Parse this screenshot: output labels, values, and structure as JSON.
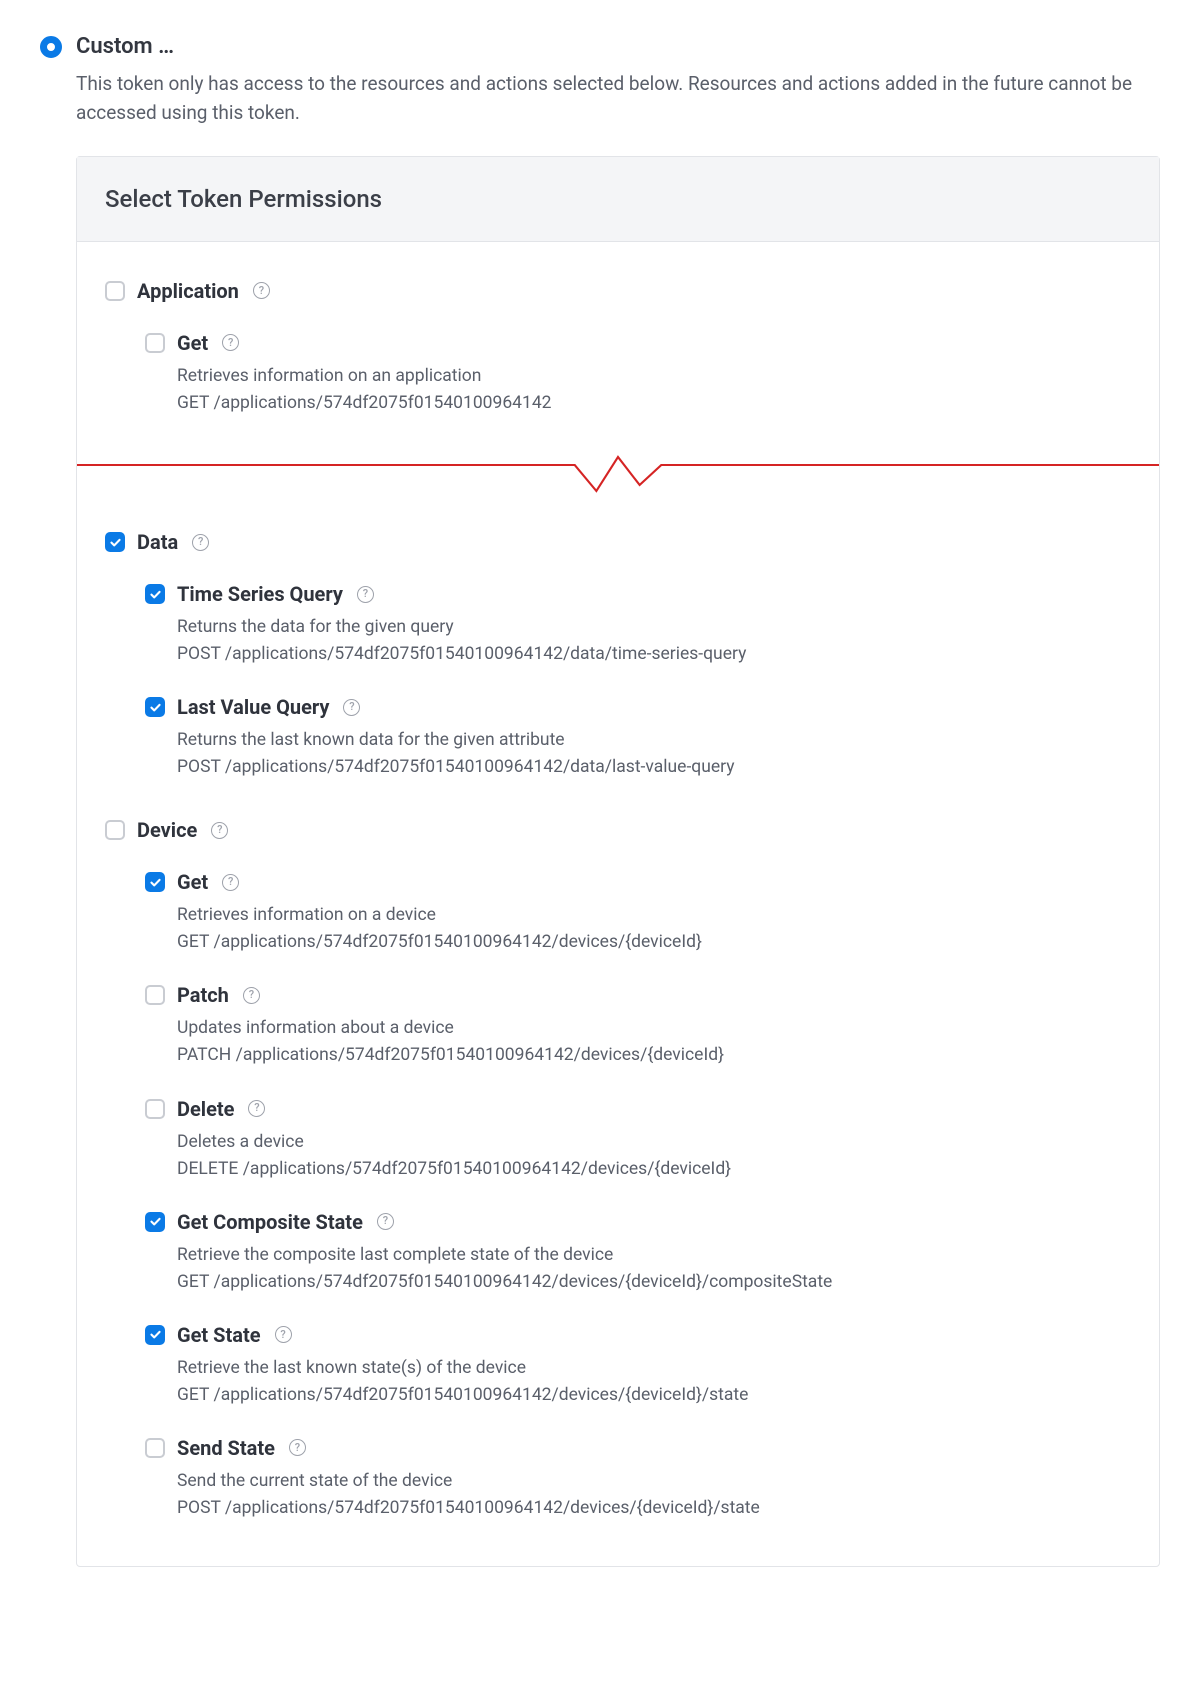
{
  "option": {
    "label": "Custom …",
    "description": "This token only has access to the resources and actions selected below. Resources and actions added in the future cannot be accessed using this token."
  },
  "panel": {
    "title": "Select Token Permissions"
  },
  "groups": [
    {
      "name": "Application",
      "checked": false,
      "hasTearAfterItems": true,
      "items": [
        {
          "name": "Get",
          "checked": false,
          "desc": "Retrieves information on an application",
          "api": "GET /applications/574df2075f01540100964142"
        }
      ]
    },
    {
      "name": "Data",
      "checked": true,
      "items": [
        {
          "name": "Time Series Query",
          "checked": true,
          "desc": "Returns the data for the given query",
          "api": "POST /applications/574df2075f01540100964142/data/time-series-query"
        },
        {
          "name": "Last Value Query",
          "checked": true,
          "desc": "Returns the last known data for the given attribute",
          "api": "POST /applications/574df2075f01540100964142/data/last-value-query"
        }
      ]
    },
    {
      "name": "Device",
      "checked": false,
      "items": [
        {
          "name": "Get",
          "checked": true,
          "desc": "Retrieves information on a device",
          "api": "GET /applications/574df2075f01540100964142/devices/{deviceId}"
        },
        {
          "name": "Patch",
          "checked": false,
          "desc": "Updates information about a device",
          "api": "PATCH /applications/574df2075f01540100964142/devices/{deviceId}"
        },
        {
          "name": "Delete",
          "checked": false,
          "desc": "Deletes a device",
          "api": "DELETE /applications/574df2075f01540100964142/devices/{deviceId}"
        },
        {
          "name": "Get Composite State",
          "checked": true,
          "desc": "Retrieve the composite last complete state of the device",
          "api": "GET /applications/574df2075f01540100964142/devices/{deviceId}/compositeState"
        },
        {
          "name": "Get State",
          "checked": true,
          "desc": "Retrieve the last known state(s) of the device",
          "api": "GET /applications/574df2075f01540100964142/devices/{deviceId}/state"
        },
        {
          "name": "Send State",
          "checked": false,
          "desc": "Send the current state of the device",
          "api": "POST /applications/574df2075f01540100964142/devices/{deviceId}/state"
        }
      ]
    }
  ]
}
